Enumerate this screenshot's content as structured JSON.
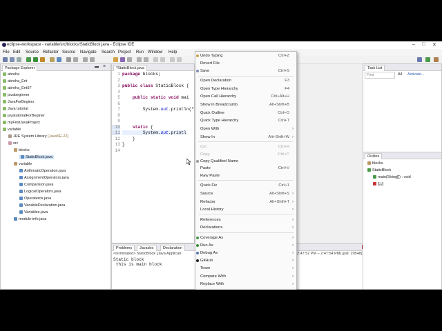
{
  "window": {
    "title": "eclipse-workspace - variable/src/blocks/StaticBlock.java - Eclipse IDE"
  },
  "menubar": [
    "File",
    "Edit",
    "Source",
    "Refactor",
    "Source",
    "Navigate",
    "Search",
    "Project",
    "Run",
    "Window",
    "Help"
  ],
  "package_explorer": {
    "tab": "Package Explorer",
    "items": [
      "abreha",
      "abreha_Ent",
      "abreha_Ent57",
      "javabeginner",
      "JavaForBegiers",
      "Java tutorial",
      "javatutorialForBeginer",
      "myFirstJavaProject",
      "variable",
      "JRE System Library",
      "[JavaSE-22]",
      "src",
      "blocks",
      "StaticBlock.java",
      "variable",
      "ArithmaticOperation.java",
      "AssignmentOperators.java",
      "Comparision.java",
      "LogicalOperators.java",
      "Operateros.java",
      "VariableDeclaration.java",
      "Variables.java",
      "module-info.java"
    ]
  },
  "editor": {
    "tab": "*StaticBlock.java",
    "lines": [
      "1",
      "2",
      "3",
      "4",
      "5",
      "6",
      "7",
      "8",
      "9",
      "10",
      "11",
      "12",
      "13",
      "14"
    ],
    "code": {
      "l1_kw": "package",
      "l1_rest": " blocks;",
      "l3_kw": "public class",
      "l3_rest": " StaticBlock {",
      "l5_kw": "    public static void",
      "l5_rest": " mai",
      "l7_a": "        System.",
      "l7_b": "out",
      "l7_c": ".println(\"",
      "l10_kw": "    static",
      "l10_rest": " {",
      "l11_a": "        System.",
      "l11_b": "out",
      "l11_c": ".printl",
      "l12": "    }",
      "l13": "}"
    }
  },
  "console": {
    "tabs": [
      "Problems",
      "Javadoc",
      "Declaration"
    ],
    "status_left": "<terminated> StaticBlock [Java Applicati",
    "status_right": "2:47:52 PM – 2:47:54 PM) [pid: 20548]",
    "output": [
      "Static block",
      " this is main block"
    ]
  },
  "task_list": {
    "tab": "Task List",
    "find_placeholder": "Find",
    "all_label": "All",
    "activate_label": "Activate..."
  },
  "outline": {
    "tab": "Outline",
    "items": [
      "blocks",
      "StaticBlock",
      "main(String[]) : void",
      "{...}"
    ]
  },
  "context_menu": {
    "items": [
      {
        "label": "Undo Typing",
        "shortcut": "Ctrl+Z"
      },
      {
        "label": "Revert File",
        "shortcut": ""
      },
      {
        "label": "Save",
        "shortcut": "Ctrl+S"
      },
      {
        "label": "Open Declaration",
        "shortcut": "F3"
      },
      {
        "label": "Open Type Hierarchy",
        "shortcut": "F4"
      },
      {
        "label": "Open Call Hierarchy",
        "shortcut": "Ctrl+Alt+H"
      },
      {
        "label": "Show in Breadcrumb",
        "shortcut": "Alt+Shift+B"
      },
      {
        "label": "Quick Outline",
        "shortcut": "Ctrl+O"
      },
      {
        "label": "Quick Type Hierarchy",
        "shortcut": "Ctrl+T"
      },
      {
        "label": "Open With",
        "shortcut": ""
      },
      {
        "label": "Show In",
        "shortcut": "Alt+Shift+W"
      },
      {
        "label": "Cut",
        "shortcut": "Ctrl+X"
      },
      {
        "label": "Copy",
        "shortcut": "Ctrl+C"
      },
      {
        "label": "Copy Qualified Name",
        "shortcut": ""
      },
      {
        "label": "Paste",
        "shortcut": "Ctrl+V"
      },
      {
        "label": "Raw Paste",
        "shortcut": ""
      },
      {
        "label": "Quick Fix",
        "shortcut": "Ctrl+1"
      },
      {
        "label": "Source",
        "shortcut": "Alt+Shift+S"
      },
      {
        "label": "Refactor",
        "shortcut": "Alt+Shift+T"
      },
      {
        "label": "Local History",
        "shortcut": ""
      },
      {
        "label": "References",
        "shortcut": ""
      },
      {
        "label": "Declarations",
        "shortcut": ""
      },
      {
        "label": "Coverage As",
        "shortcut": ""
      },
      {
        "label": "Run As",
        "shortcut": ""
      },
      {
        "label": "Debug As",
        "shortcut": ""
      },
      {
        "label": "GitHub",
        "shortcut": ""
      },
      {
        "label": "Team",
        "shortcut": ""
      },
      {
        "label": "Compare With",
        "shortcut": ""
      },
      {
        "label": "Replace With",
        "shortcut": ""
      }
    ]
  },
  "colors": {
    "menu_bg": "#fafafa",
    "keyword": "#7f0055",
    "string": "#2a00ff"
  }
}
